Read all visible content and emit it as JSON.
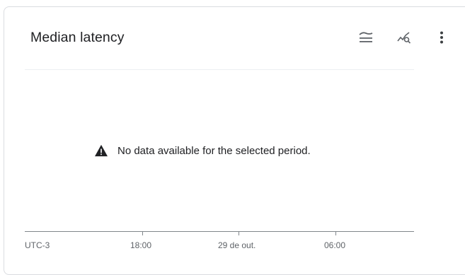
{
  "card": {
    "title": "Median latency",
    "actions": [
      {
        "icon": "legend-toggle-icon"
      },
      {
        "icon": "explore-chart-icon"
      },
      {
        "icon": "more-vert-icon"
      }
    ]
  },
  "empty_state": {
    "icon": "warning-icon",
    "message": "No data available for the selected period."
  },
  "x_axis": {
    "timezone_label": "UTC-3",
    "ticks": [
      "18:00",
      "29 de out.",
      "06:00"
    ]
  },
  "colors": {
    "text": "#202124",
    "icon": "#5f6368",
    "axis": "#80868b",
    "border": "#dadce0"
  }
}
